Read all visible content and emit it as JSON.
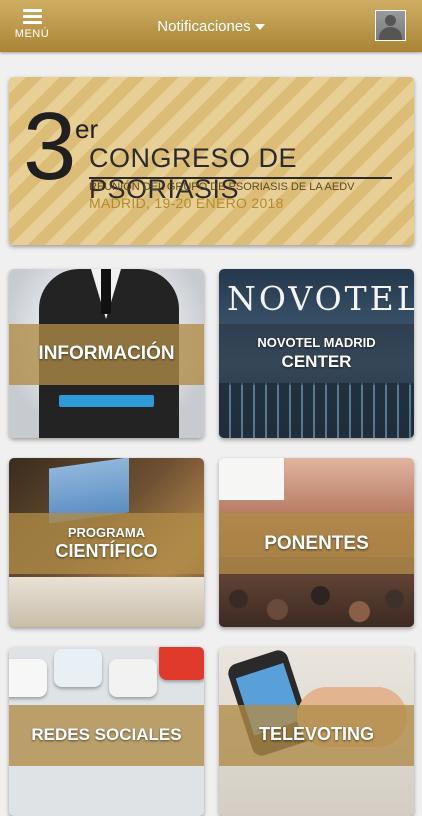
{
  "header": {
    "menu_label": "MENÚ",
    "title": "Notificaciones",
    "menu_icon": "hamburger-icon",
    "dropdown_icon": "caret-down-icon",
    "avatar_icon": "user-avatar-icon"
  },
  "banner": {
    "number": "3",
    "superscript": "er",
    "title": "CONGRESO DE PSORIASIS",
    "subtitle": "REUNIÓN DEL GRUPO DE PSORIASIS DE LA AEDV",
    "dates": "MADRID, 19-20 ENERO 2018"
  },
  "tiles": [
    {
      "id": "informacion",
      "label": "INFORMACIÓN"
    },
    {
      "id": "hotel",
      "sign": "NOVOTEL",
      "line1": "NOVOTEL MADRID",
      "line2": "CENTER"
    },
    {
      "id": "programa",
      "line1": "PROGRAMA",
      "line2": "CIENTÍFICO"
    },
    {
      "id": "ponentes",
      "label": "PONENTES"
    },
    {
      "id": "redes",
      "label": "REDES SOCIALES"
    },
    {
      "id": "televoting",
      "label": "TELEVOTING"
    }
  ],
  "colors": {
    "gold": "#b08c48",
    "topbar": "#c3a052"
  }
}
